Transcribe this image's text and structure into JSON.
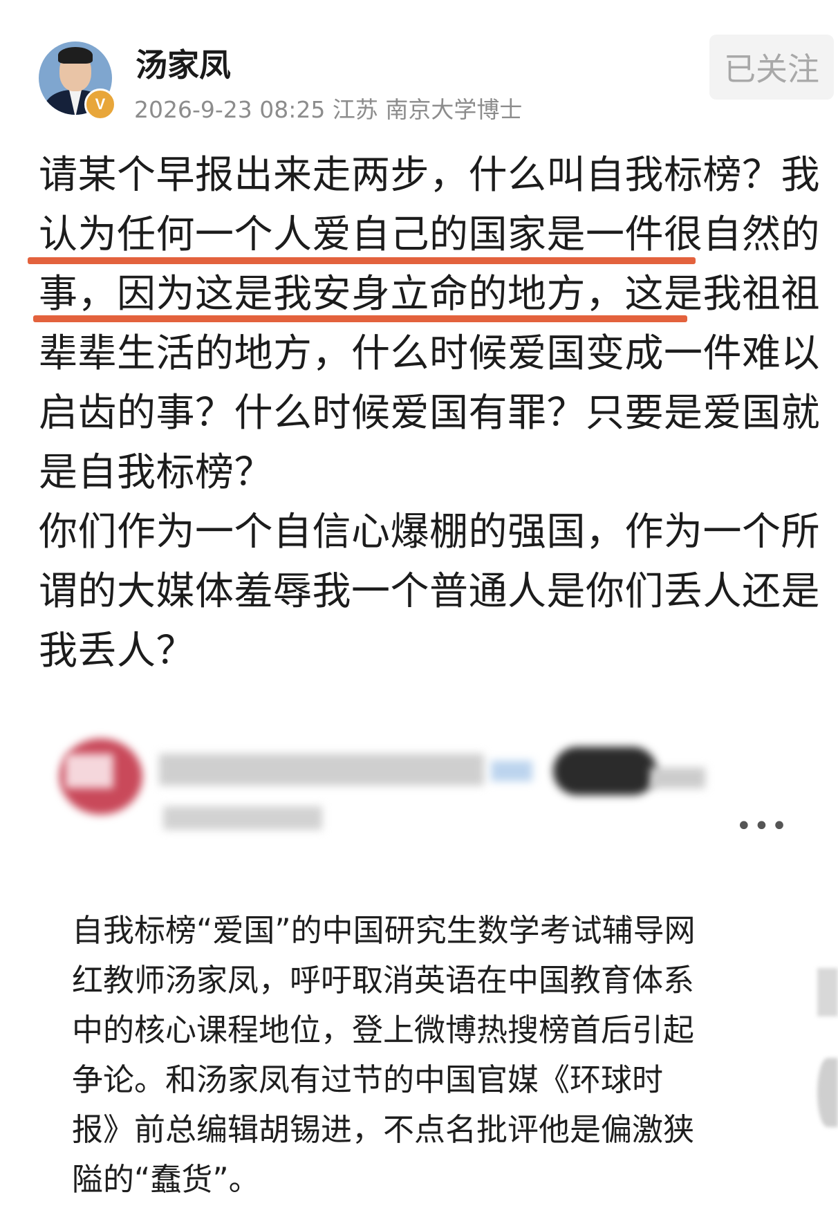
{
  "header": {
    "username": "汤家凤",
    "meta": "2026-9-23 08:25 江苏 南京大学博士",
    "follow_label": "已关注",
    "badge": "V"
  },
  "post": {
    "lines": [
      "请某个早报出来走两步，什么叫自我标榜？我",
      "认为任何一个人爱自己的国家是一件很自然的",
      "事，因为这是我安身立命的地方，这是我祖祖",
      "辈辈生活的地方，什么时候爱国变成一件难以",
      "启齿的事？什么时候爱国有罪？只要是爱国就",
      "是自我标榜？",
      "你们作为一个自信心爆棚的强国，作为一个所",
      "谓的大媒体羞辱我一个普通人是你们丢人还是",
      "我丢人？"
    ],
    "underline_color": "#e3623d"
  },
  "quoted": {
    "more_label": "•••",
    "lines": [
      "自我标榜“爱国”的中国研究生数学考试辅导网",
      "红教师汤家凤，呼吁取消英语在中国教育体系",
      "中的核心课程地位，登上微博热搜榜首后引起",
      "争论。和汤家凤有过节的中国官媒《环球时",
      "报》前总编辑胡锡进，不点名批评他是偏激狭",
      "隘的“蠢货”。"
    ]
  }
}
